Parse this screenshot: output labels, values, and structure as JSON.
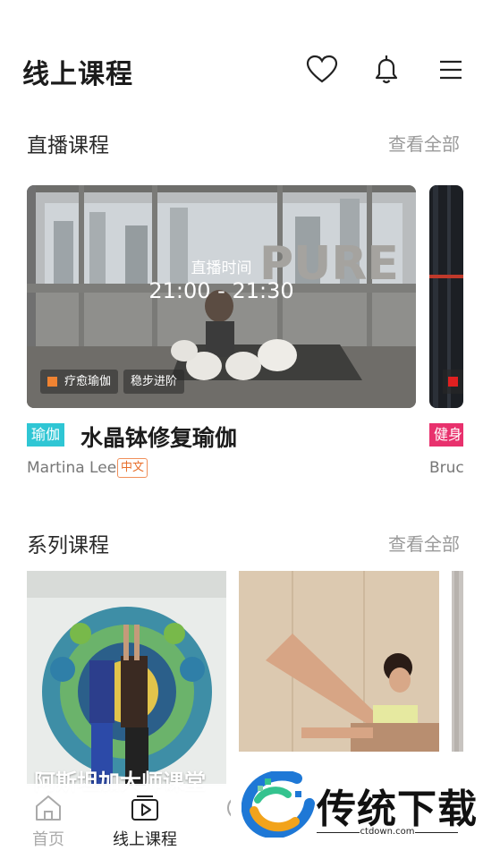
{
  "header": {
    "title": "线上课程",
    "icons": [
      "heart-icon",
      "bell-icon",
      "menu-icon"
    ]
  },
  "live_section": {
    "title": "直播课程",
    "more": "查看全部",
    "cards": [
      {
        "time_label": "直播时间",
        "time": "21:00 - 21:30",
        "tags": [
          "疗愈瑜伽",
          "稳步进阶"
        ],
        "category": "瑜伽",
        "category_color": "#2fc6d4",
        "name": "水晶钵修复瑜伽",
        "instructor": "Martina Lee",
        "language": "中文"
      },
      {
        "category": "健身",
        "category_color": "#e8316d",
        "instructor": "Bruc"
      }
    ]
  },
  "series_section": {
    "title": "系列课程",
    "more": "查看全部",
    "cards": [
      {
        "title": "阿斯坦加大师课堂"
      }
    ]
  },
  "bottom_nav": {
    "items": [
      {
        "label": "首页",
        "icon": "home-icon",
        "active": false
      },
      {
        "label": "线上课程",
        "icon": "play-icon",
        "active": true
      },
      {
        "label": "线",
        "icon": "offline-icon",
        "active": false
      }
    ]
  },
  "watermark": {
    "text": "传统下载",
    "url": "ctdown.com"
  },
  "colors": {
    "accent_orange": "#f08332",
    "yoga_badge": "#2fc6d4",
    "fitness_badge": "#e8316d"
  }
}
